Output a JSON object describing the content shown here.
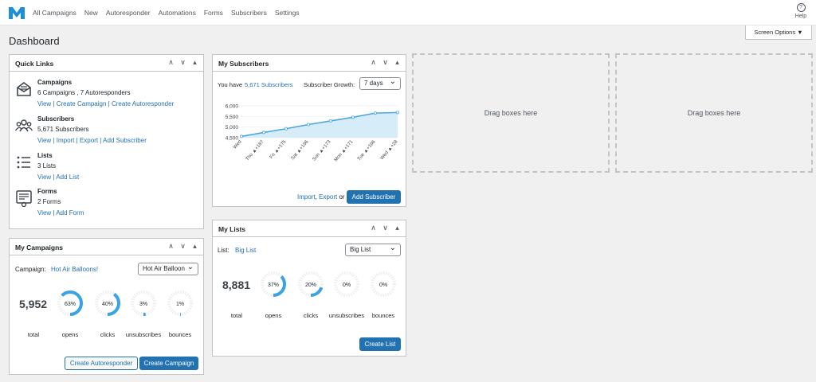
{
  "nav": [
    "All Campaigns",
    "New",
    "Autoresponder",
    "Automations",
    "Forms",
    "Subscribers",
    "Settings"
  ],
  "help": {
    "icon": "?",
    "label": "Help"
  },
  "page_title": "Dashboard",
  "screen_options": "Screen Options ▼",
  "quick_links": {
    "title": "Quick Links",
    "items": [
      {
        "heading": "Campaigns",
        "summary": "6 Campaigns , 7 Autoresponders",
        "links": [
          "View",
          "Create Campaign",
          "Create Autoresponder"
        ]
      },
      {
        "heading": "Subscribers",
        "summary": "5,671 Subscribers",
        "links": [
          "View",
          "Import",
          "Export",
          "Add Subscriber"
        ]
      },
      {
        "heading": "Lists",
        "summary": "3 Lists",
        "links": [
          "View",
          "Add List"
        ]
      },
      {
        "heading": "Forms",
        "summary": "2 Forms",
        "links": [
          "View",
          "Add Form"
        ]
      }
    ]
  },
  "my_subscribers": {
    "title": "My Subscribers",
    "you_have": "You have",
    "count_link": "5,671 Subscribers",
    "growth_label": "Subscriber Growth:",
    "growth_select": "7 days",
    "import_link": "Import",
    "export_link": "Export",
    "or": "or",
    "add_button": "Add Subscriber"
  },
  "chart_data": {
    "type": "area",
    "categories": [
      "Wed",
      "Thu ▲+187",
      "Fri ▲+175",
      "Sat ▲+196",
      "Sun ▲+173",
      "Mon ▲+171",
      "Tue ▲+196",
      "Wed ▲+28"
    ],
    "values": [
      4560,
      4747,
      4922,
      5118,
      5291,
      5462,
      5658,
      5686
    ],
    "yticks": [
      "6,000",
      "5,500",
      "5,000",
      "4,500"
    ],
    "ylim": [
      4500,
      6000
    ],
    "color": "#4aa8e0"
  },
  "drop_zone_text": "Drag boxes here",
  "my_campaigns": {
    "title": "My Campaigns",
    "campaign_label": "Campaign:",
    "campaign_link": "Hot Air Balloons!",
    "select": "Hot Air Balloon",
    "total": "5,952",
    "total_label": "total",
    "stats": [
      {
        "pct": 63,
        "label": "opens"
      },
      {
        "pct": 40,
        "label": "clicks"
      },
      {
        "pct": 3,
        "label": "unsubscribes"
      },
      {
        "pct": 1,
        "label": "bounces"
      }
    ],
    "btn_autoresponder": "Create Autoresponder",
    "btn_campaign": "Create Campaign"
  },
  "my_lists": {
    "title": "My Lists",
    "list_label": "List:",
    "list_link": "Big List",
    "select": "Big List",
    "total": "8,881",
    "total_label": "total",
    "stats": [
      {
        "pct": 37,
        "label": "opens"
      },
      {
        "pct": 20,
        "label": "clicks"
      },
      {
        "pct": 0,
        "label": "unsubscribes"
      },
      {
        "pct": 0,
        "label": "bounces"
      }
    ],
    "btn_create": "Create List"
  },
  "colors": {
    "accent": "#2271b1",
    "donut": "#3aa3e3"
  }
}
